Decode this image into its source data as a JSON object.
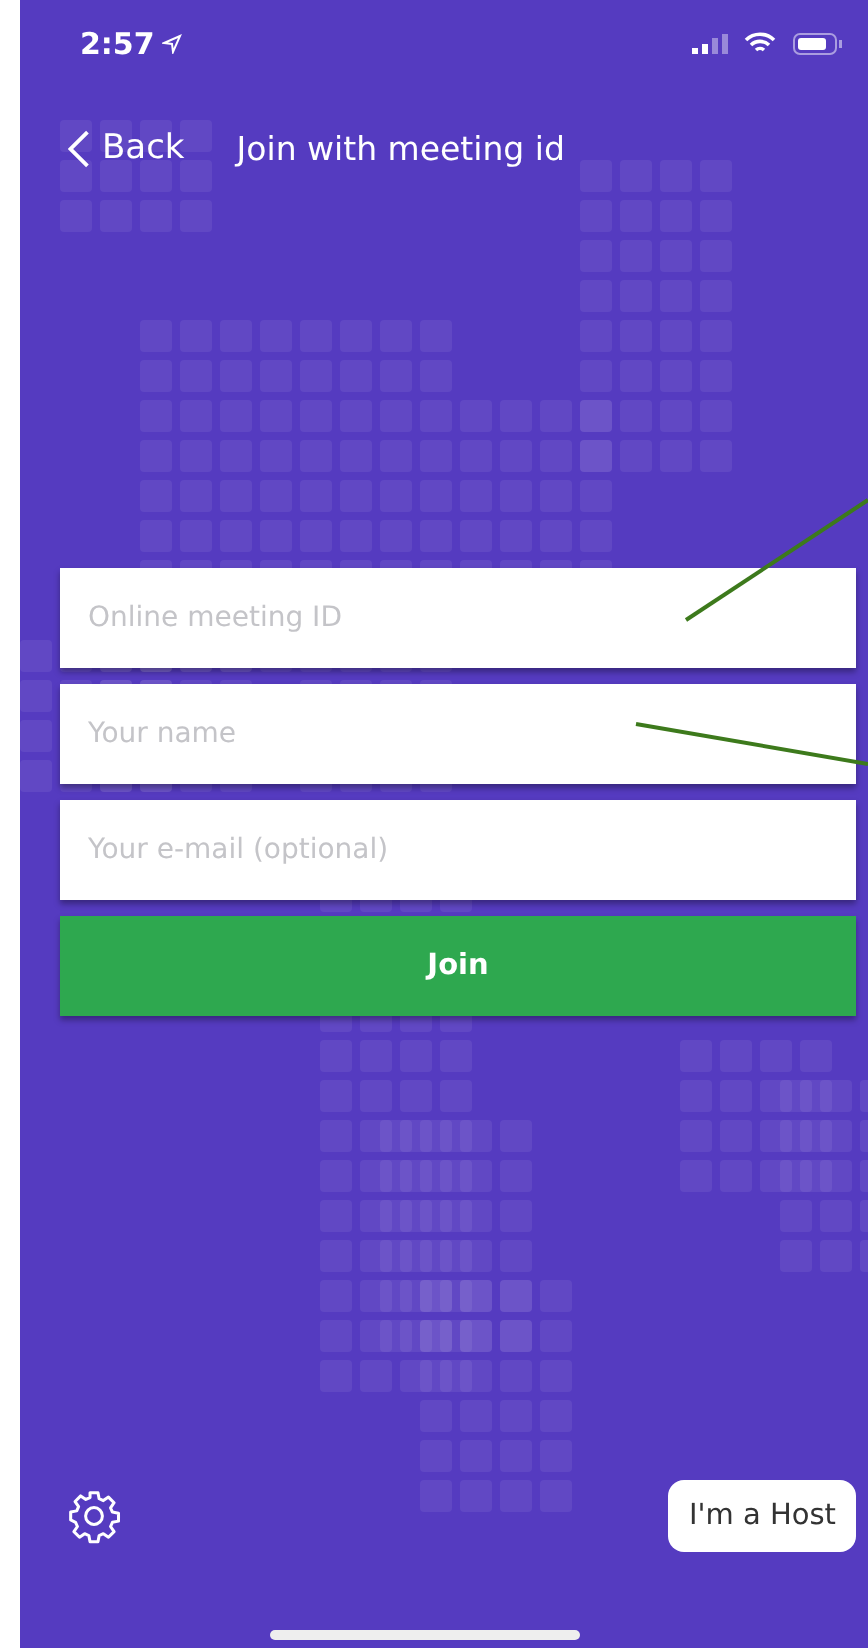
{
  "status_bar": {
    "time": "2:57"
  },
  "nav": {
    "back": "Back",
    "title": "Join with meeting id"
  },
  "fields": [
    {
      "placeholder": "Online meeting ID"
    },
    {
      "placeholder": "Your name"
    },
    {
      "placeholder": "Your e-mail (optional)"
    }
  ],
  "join_button": "Join",
  "host_button": "I'm a Host"
}
